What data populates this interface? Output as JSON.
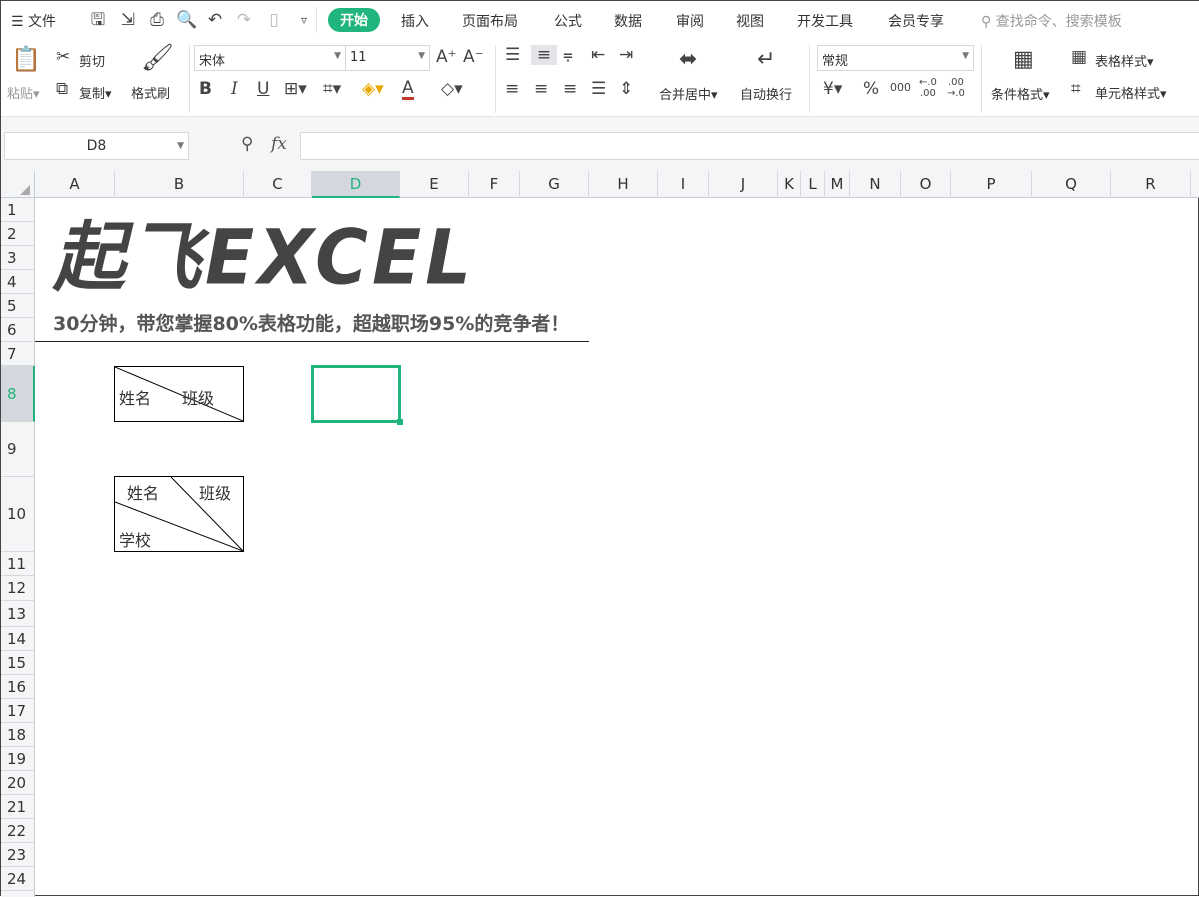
{
  "menubar": {
    "file": "文件",
    "tabs": [
      "开始",
      "插入",
      "页面布局",
      "公式",
      "数据",
      "审阅",
      "视图",
      "开发工具",
      "会员专享"
    ],
    "active_tab": "开始",
    "search_placeholder": "查找命令、搜索模板"
  },
  "ribbon": {
    "paste": "粘贴",
    "cut": "剪切",
    "copy": "复制",
    "format_painter": "格式刷",
    "font_name": "宋体",
    "font_size": "11",
    "merge_center": "合并居中",
    "wrap_text": "自动换行",
    "number_format": "常规",
    "conditional_format": "条件格式",
    "table_style": "表格样式",
    "cell_style": "单元格样式",
    "bold": "B",
    "italic": "I",
    "underline": "U",
    "currency": "¥",
    "percent": "%"
  },
  "formula_bar": {
    "name_box": "D8",
    "fx": "fx",
    "value": ""
  },
  "columns": [
    "A",
    "B",
    "C",
    "D",
    "E",
    "F",
    "G",
    "H",
    "I",
    "J",
    "K",
    "L",
    "M",
    "N",
    "O",
    "P",
    "Q",
    "R"
  ],
  "selected_column": "D",
  "rows": [
    "1",
    "2",
    "3",
    "4",
    "5",
    "6",
    "7",
    "8",
    "9",
    "10",
    "11",
    "12",
    "13",
    "14",
    "15",
    "16",
    "17",
    "18",
    "19",
    "20",
    "21",
    "22",
    "23",
    "24"
  ],
  "selected_row": "8",
  "sheet": {
    "title": "起飞EXCEL",
    "subtitle": "30分钟，带您掌握80%表格功能，超越职场95%的竞争者！",
    "cell_b8": {
      "left": "姓名",
      "right": "班级"
    },
    "cell_b10": {
      "top_left": "姓名",
      "top_right": "班级",
      "bottom": "学校"
    }
  },
  "colors": {
    "accent": "#1fb57c"
  }
}
